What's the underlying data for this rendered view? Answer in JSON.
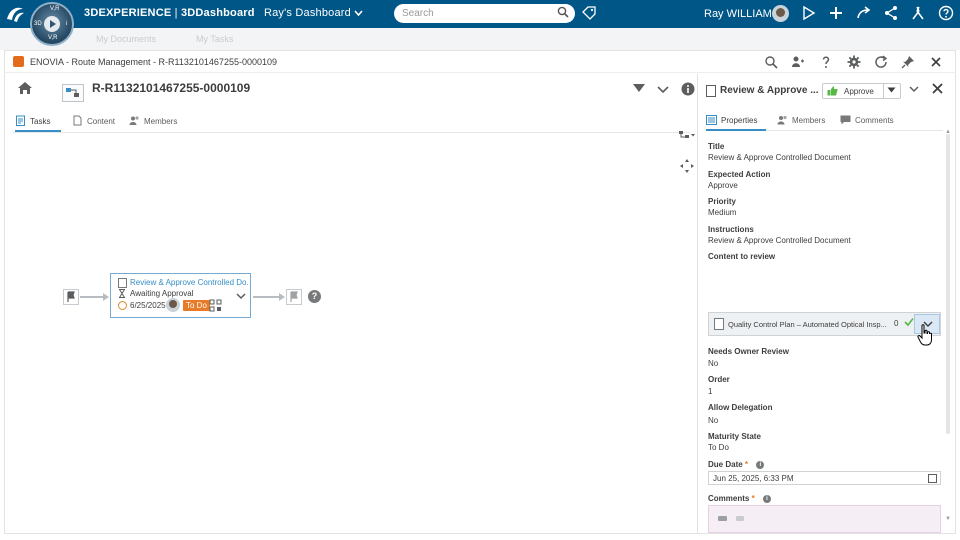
{
  "topbar": {
    "brand_prefix": "3DEXPERIENCE",
    "brand_sep": " | ",
    "brand_app": "3DDashboard",
    "dashboard_name": "Ray's Dashboard",
    "search_placeholder": "Search",
    "user_name": "Ray WILLIAM",
    "compass_top": "V,R",
    "compass_left": "3D",
    "compass_right": "i",
    "compass_bottom": "V,R"
  },
  "subbar": {
    "tab1": "My Documents",
    "tab2": "My Tasks"
  },
  "app": {
    "title": "ENOVIA - Route Management - R-R1132101467255-0000109"
  },
  "left": {
    "route_title": "R-R1132101467255-0000109",
    "tabs": [
      {
        "label": "Tasks"
      },
      {
        "label": "Content"
      },
      {
        "label": "Members"
      }
    ],
    "task_card": {
      "title": "Review & Approve Controlled Do...",
      "status": "Awaiting Approval",
      "date": "6/25/2025",
      "badge": "To Do"
    }
  },
  "right": {
    "title": "Review & Approve ...",
    "approve_label": "Approve",
    "tabs": [
      {
        "label": "Properties"
      },
      {
        "label": "Members"
      },
      {
        "label": "Comments"
      }
    ],
    "fields": {
      "title_label": "Title",
      "title_value": "Review & Approve Controlled Document",
      "expected_action_label": "Expected Action",
      "expected_action_value": "Approve",
      "priority_label": "Priority",
      "priority_value": "Medium",
      "instructions_label": "Instructions",
      "instructions_value": "Review & Approve Controlled Document",
      "content_label": "Content to review",
      "content_item": "Quality Control Plan – Automated Optical Insp...",
      "content_count": "0",
      "needs_owner_label": "Needs Owner Review",
      "needs_owner_value": "No",
      "order_label": "Order",
      "order_value": "1",
      "allow_delegation_label": "Allow Delegation",
      "allow_delegation_value": "No",
      "maturity_label": "Maturity State",
      "maturity_value": "To Do",
      "due_date_label": "Due Date",
      "due_date_value": "Jun 25, 2025, 6:33 PM",
      "comments_label": "Comments"
    }
  },
  "colors": {
    "topbar": "#005686",
    "accent": "#368ec4",
    "badge": "#e87b27",
    "approve_green": "#57b847"
  },
  "icons": [
    "3ds-logo-icon",
    "compass-icon",
    "search-icon",
    "tag-icon",
    "share-icon",
    "plus-icon",
    "forward-icon",
    "network-icon",
    "tools-icon",
    "help-icon",
    "home-icon",
    "filter-icon",
    "info-icon",
    "flag-icon",
    "thumbs-up-icon",
    "close-icon",
    "calendar-icon",
    "cursor-hand-icon"
  ]
}
